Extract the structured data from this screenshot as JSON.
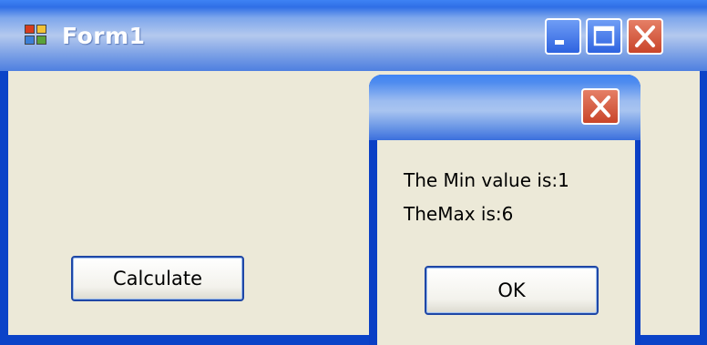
{
  "window": {
    "title": "Form1",
    "icons": {
      "app": "app-icon",
      "minimize": "minimize-icon",
      "maximize": "maximize-icon",
      "close": "close-icon"
    }
  },
  "form": {
    "calculate_label": "Calculate"
  },
  "message_box": {
    "line1": "The Min value is:1",
    "line2": "TheMax is:6",
    "ok_label": "OK",
    "close_icon": "close-icon"
  },
  "colors": {
    "titlebar_blue": "#2f6fe6",
    "frame_blue": "#0b43c8",
    "client_background": "#ece9d8",
    "close_red": "#c9452a"
  }
}
